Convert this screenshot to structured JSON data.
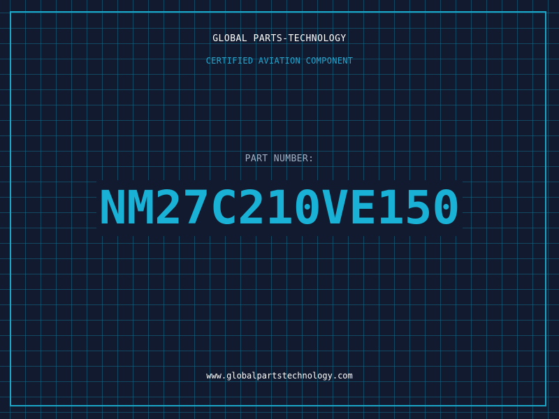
{
  "header": {
    "company_name": "GLOBAL PARTS-TECHNOLOGY",
    "tagline": "CERTIFIED AVIATION COMPONENT"
  },
  "part": {
    "label": "PART NUMBER:",
    "number": "NM27C210VE150"
  },
  "footer": {
    "website": "www.globalpartstechnology.com"
  },
  "colors": {
    "background": "#111a2e",
    "grid": "#146e8c",
    "accent": "#19b2d6",
    "frame": "#1ba6c7",
    "text_primary": "#ffffff",
    "text_muted": "#a3b1c6"
  }
}
